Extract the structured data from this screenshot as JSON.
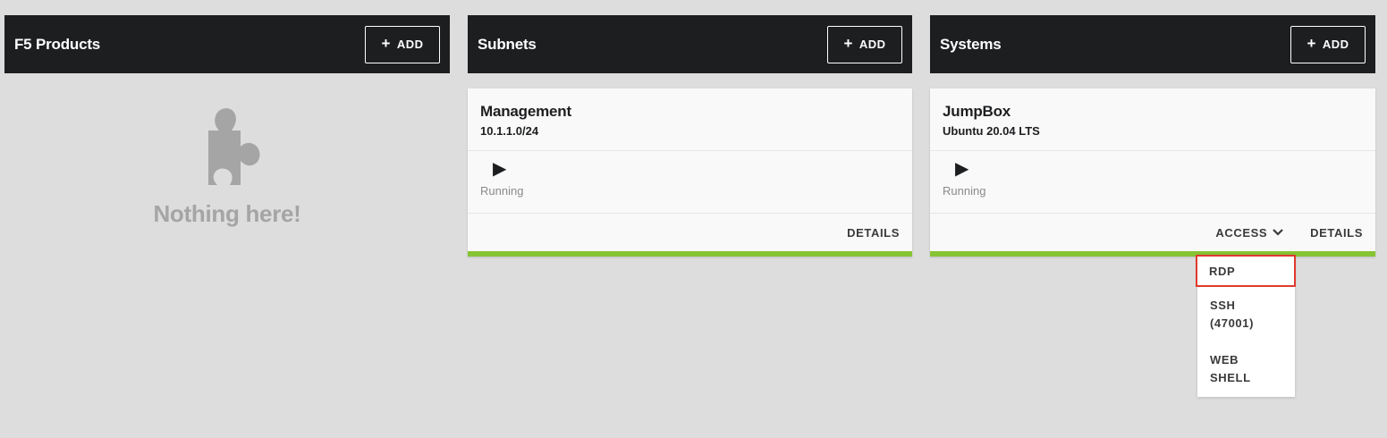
{
  "columns": [
    {
      "title": "F5 Products",
      "add_label": "ADD"
    },
    {
      "title": "Subnets",
      "add_label": "ADD"
    },
    {
      "title": "Systems",
      "add_label": "ADD"
    }
  ],
  "empty_state": {
    "text": "Nothing here!",
    "icon": "puzzle-piece-icon"
  },
  "subnet_card": {
    "title": "Management",
    "subtitle": "10.1.1.0/24",
    "status": "Running",
    "details_label": "DETAILS"
  },
  "system_card": {
    "title": "JumpBox",
    "subtitle": "Ubuntu 20.04 LTS",
    "status": "Running",
    "access_label": "ACCESS",
    "details_label": "DETAILS"
  },
  "access_menu": {
    "items": [
      "RDP",
      "SSH (47001)",
      "WEB SHELL"
    ]
  },
  "colors": {
    "header_bg": "#1d1e20",
    "page_bg": "#dcdddc",
    "status_bar": "#86c433",
    "highlight": "#e0392d"
  }
}
